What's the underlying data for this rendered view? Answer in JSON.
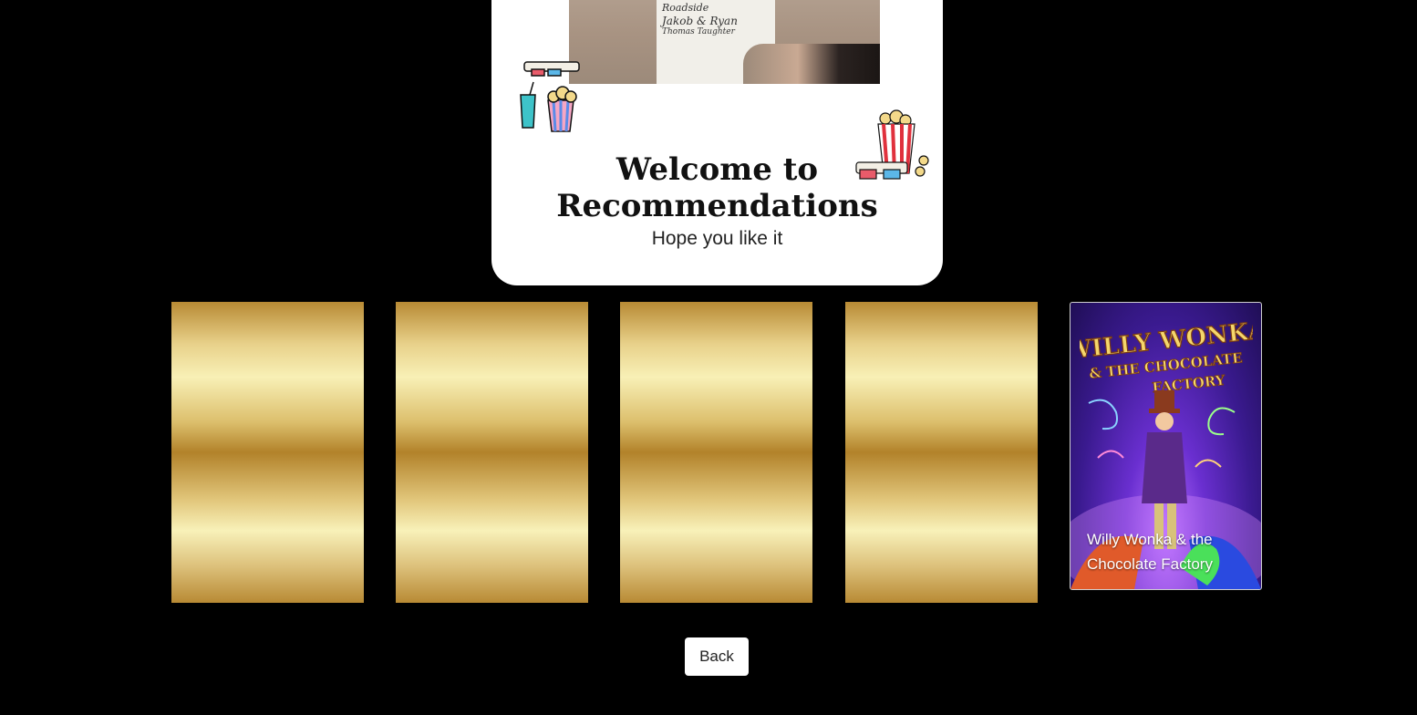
{
  "hero": {
    "title_line1": "Welcome to",
    "title_line2": "Recommendations",
    "subtitle": "Hope you like it",
    "clapper_lines": [
      "Roadside",
      "Jakob & Ryan",
      "Thomas Taughter"
    ]
  },
  "tiles": [
    {
      "state": "placeholder"
    },
    {
      "state": "placeholder"
    },
    {
      "state": "placeholder"
    },
    {
      "state": "placeholder"
    }
  ],
  "movie": {
    "caption": "Willy Wonka & the Chocolate Factory",
    "poster_art_title": "WILLY WONKA & THE CHOCOLATE FACTORY"
  },
  "back_label": "Back",
  "colors": {
    "background": "#000000",
    "gold_dark": "#b2822a",
    "gold_light": "#f8f0b6",
    "poster_purple": "#6a2fd0"
  }
}
